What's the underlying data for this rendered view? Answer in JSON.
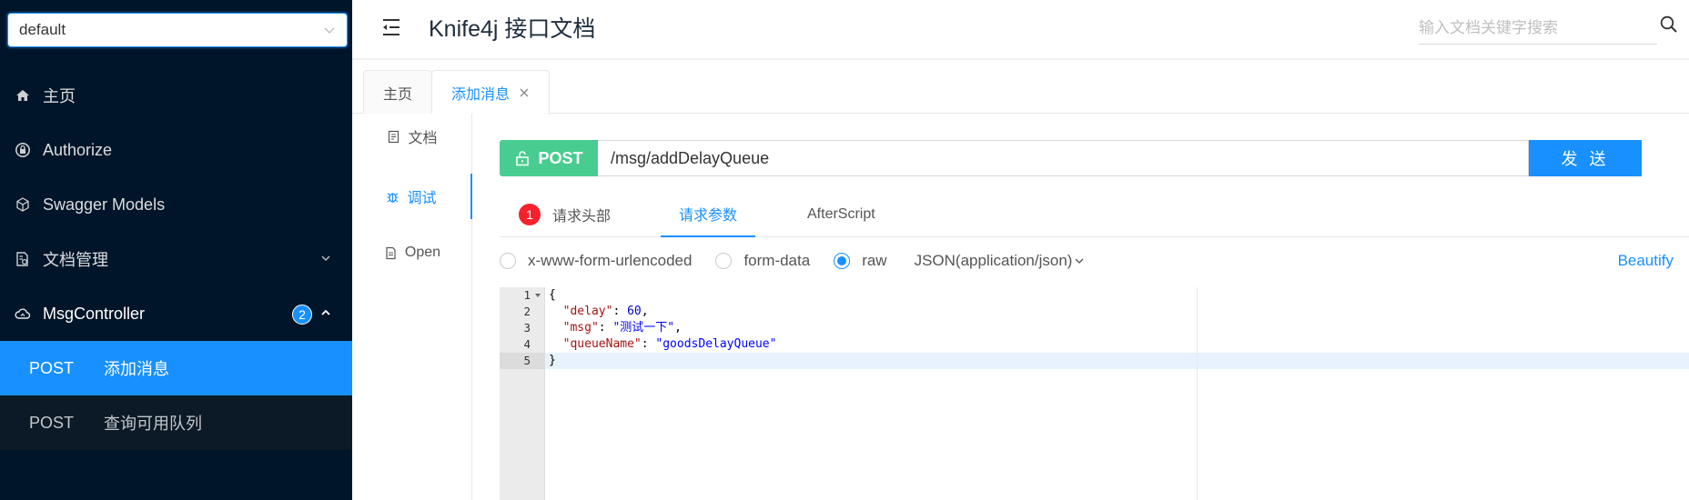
{
  "sidebar": {
    "group_select": "default",
    "menu": [
      {
        "label": "主页",
        "icon": "home-icon"
      },
      {
        "label": "Authorize",
        "icon": "lock-icon"
      },
      {
        "label": "Swagger Models",
        "icon": "code-sandbox-icon"
      },
      {
        "label": "文档管理",
        "icon": "file-settings-icon"
      }
    ],
    "controller": {
      "label": "MsgController",
      "badge": "2",
      "icon": "cloud-icon"
    },
    "endpoints": [
      {
        "method": "POST",
        "label": "添加消息",
        "active": true
      },
      {
        "method": "POST",
        "label": "查询可用队列",
        "active": false
      }
    ]
  },
  "header": {
    "title": "Knife4j 接口文档",
    "search_placeholder": "输入文档关键字搜索"
  },
  "tabs": [
    {
      "label": "主页"
    },
    {
      "label": "添加消息"
    }
  ],
  "subnav": [
    {
      "label": "文档",
      "icon": "file-icon"
    },
    {
      "label": "调试",
      "icon": "bug-icon"
    },
    {
      "label": "Open",
      "icon": "file-text-icon"
    }
  ],
  "request": {
    "method": "POST",
    "url": "/msg/addDelayQueue",
    "send_label": "发 送",
    "tabs": [
      {
        "label": "请求头部",
        "badge": "1"
      },
      {
        "label": "请求参数"
      },
      {
        "label": "AfterScript"
      }
    ],
    "content_types": [
      "x-www-form-urlencoded",
      "form-data",
      "raw"
    ],
    "raw_type": "JSON(application/json)",
    "beautify_label": "Beautify"
  },
  "editor": {
    "line_numbers": [
      "1",
      "2",
      "3",
      "4",
      "5"
    ],
    "lines": [
      {
        "parts": [
          {
            "t": "{",
            "c": ""
          }
        ]
      },
      {
        "parts": [
          {
            "t": "  ",
            "c": ""
          },
          {
            "t": "\"delay\"",
            "c": "k"
          },
          {
            "t": ": ",
            "c": ""
          },
          {
            "t": "60",
            "c": "n"
          },
          {
            "t": ",",
            "c": ""
          }
        ]
      },
      {
        "parts": [
          {
            "t": "  ",
            "c": ""
          },
          {
            "t": "\"msg\"",
            "c": "k"
          },
          {
            "t": ": ",
            "c": ""
          },
          {
            "t": "\"测试一下\"",
            "c": "s"
          },
          {
            "t": ",",
            "c": ""
          }
        ]
      },
      {
        "parts": [
          {
            "t": "  ",
            "c": ""
          },
          {
            "t": "\"queueName\"",
            "c": "k"
          },
          {
            "t": ": ",
            "c": ""
          },
          {
            "t": "\"goodsDelayQueue\"",
            "c": "s"
          }
        ]
      },
      {
        "parts": [
          {
            "t": "}",
            "c": ""
          }
        ]
      }
    ]
  },
  "colors": {
    "sidebar_bg": "#001529",
    "accent": "#1890ff",
    "post": "#49cc90",
    "error_badge": "#f5222d"
  }
}
